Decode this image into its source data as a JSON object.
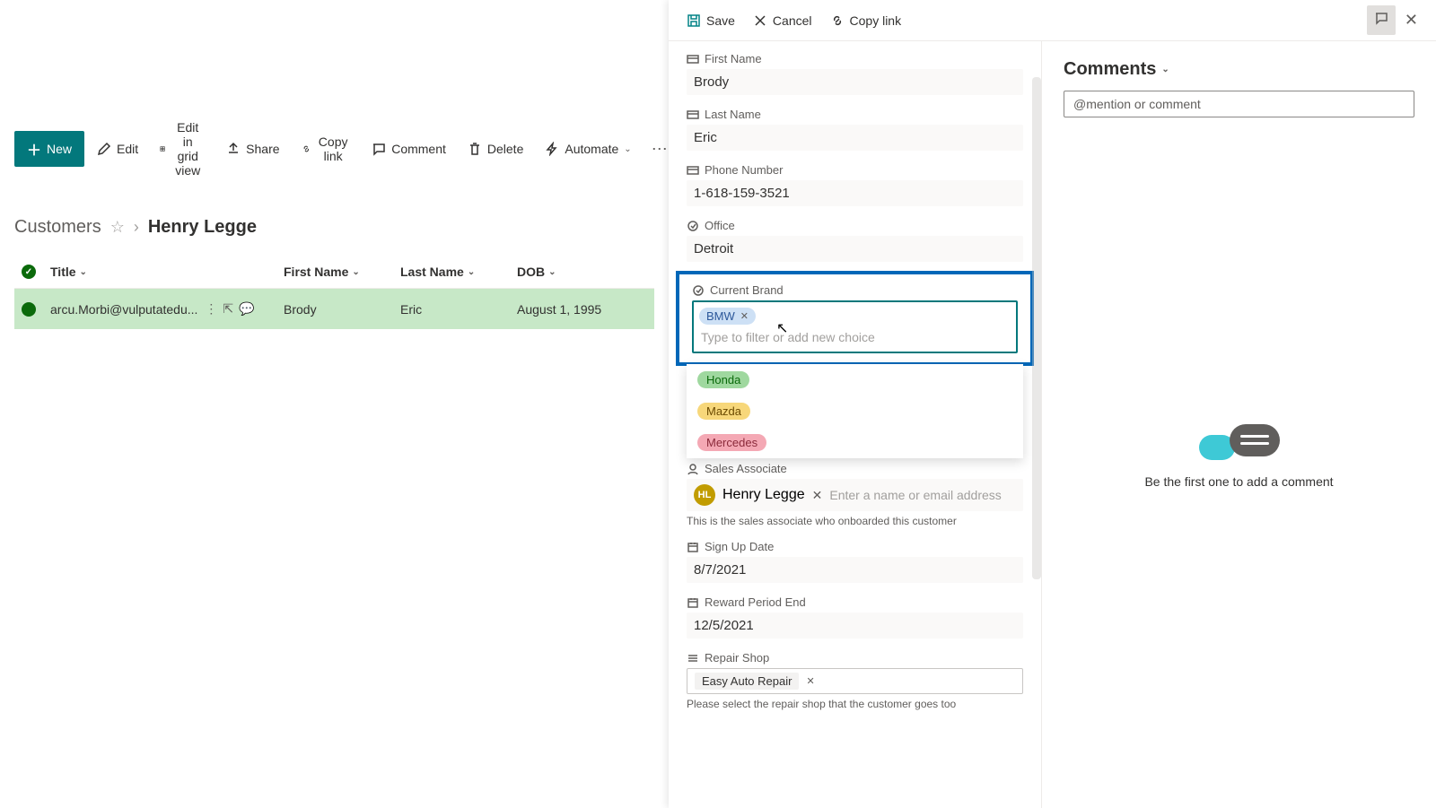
{
  "toolbar": {
    "new": "New",
    "edit": "Edit",
    "edit_grid": "Edit in grid view",
    "share": "Share",
    "copy_link": "Copy link",
    "comment": "Comment",
    "delete": "Delete",
    "automate": "Automate"
  },
  "breadcrumb": {
    "root": "Customers",
    "current": "Henry Legge"
  },
  "table": {
    "columns": [
      "Title",
      "First Name",
      "Last Name",
      "DOB"
    ],
    "row": {
      "title": "arcu.Morbi@vulputatedu...",
      "first_name": "Brody",
      "last_name": "Eric",
      "dob": "August 1, 1995"
    }
  },
  "detail_top": {
    "save": "Save",
    "cancel": "Cancel",
    "copy_link": "Copy link"
  },
  "form": {
    "first_name": {
      "label": "First Name",
      "value": "Brody"
    },
    "last_name": {
      "label": "Last Name",
      "value": "Eric"
    },
    "phone": {
      "label": "Phone Number",
      "value": "1-618-159-3521"
    },
    "office": {
      "label": "Office",
      "value": "Detroit"
    },
    "current_brand": {
      "label": "Current Brand",
      "selected": "BMW",
      "placeholder": "Type to filter or add new choice",
      "options": [
        "Honda",
        "Mazda",
        "Mercedes"
      ]
    },
    "sales_associate": {
      "label": "Sales Associate",
      "initials": "HL",
      "name": "Henry Legge",
      "placeholder": "Enter a name or email address",
      "note": "This is the sales associate who onboarded this customer"
    },
    "sign_up": {
      "label": "Sign Up Date",
      "value": "8/7/2021"
    },
    "reward_end": {
      "label": "Reward Period End",
      "value": "12/5/2021"
    },
    "repair_shop": {
      "label": "Repair Shop",
      "value": "Easy Auto Repair",
      "note": "Please select the repair shop that the customer goes too"
    }
  },
  "comments": {
    "title": "Comments",
    "placeholder": "@mention or comment",
    "empty": "Be the first one to add a comment"
  }
}
